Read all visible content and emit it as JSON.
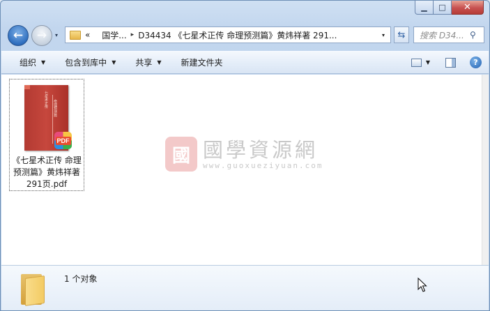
{
  "window": {
    "caption": {
      "minimize": "▁",
      "maximize": "□",
      "close": "✕"
    }
  },
  "nav": {
    "back_icon": "arrow-left-icon",
    "forward_icon": "arrow-right-icon",
    "history_dropdown": "▾",
    "breadcrumb": {
      "lead": "«",
      "items": [
        "国学...",
        "D34434 《七星术正传 命理预测篇》黄炜祥著 291..."
      ],
      "separator": "▸"
    },
    "address_dropdown": "▾",
    "refresh_label": "⇆",
    "search_placeholder": "搜索 D34...",
    "search_icon": "⚲"
  },
  "toolbar": {
    "organize": "组织",
    "include_library": "包含到库中",
    "share": "共享",
    "new_folder": "新建文件夹",
    "help": "?"
  },
  "files": [
    {
      "label": "《七星术正传 命理预测篇》黄炜祥著 291页.pdf",
      "badge": "PDF",
      "cover_title": "七星术正传",
      "cover_subtitle": "命理预测篇"
    }
  ],
  "watermark": {
    "seal": "國",
    "main": "國學資源網",
    "sub": "www.guoxueziyuan.com"
  },
  "details": {
    "count_text": "1 个对象"
  },
  "colors": {
    "accent": "#3464a6",
    "cover_red": "#b33a32",
    "pane_bg": "#dfe9f5"
  }
}
